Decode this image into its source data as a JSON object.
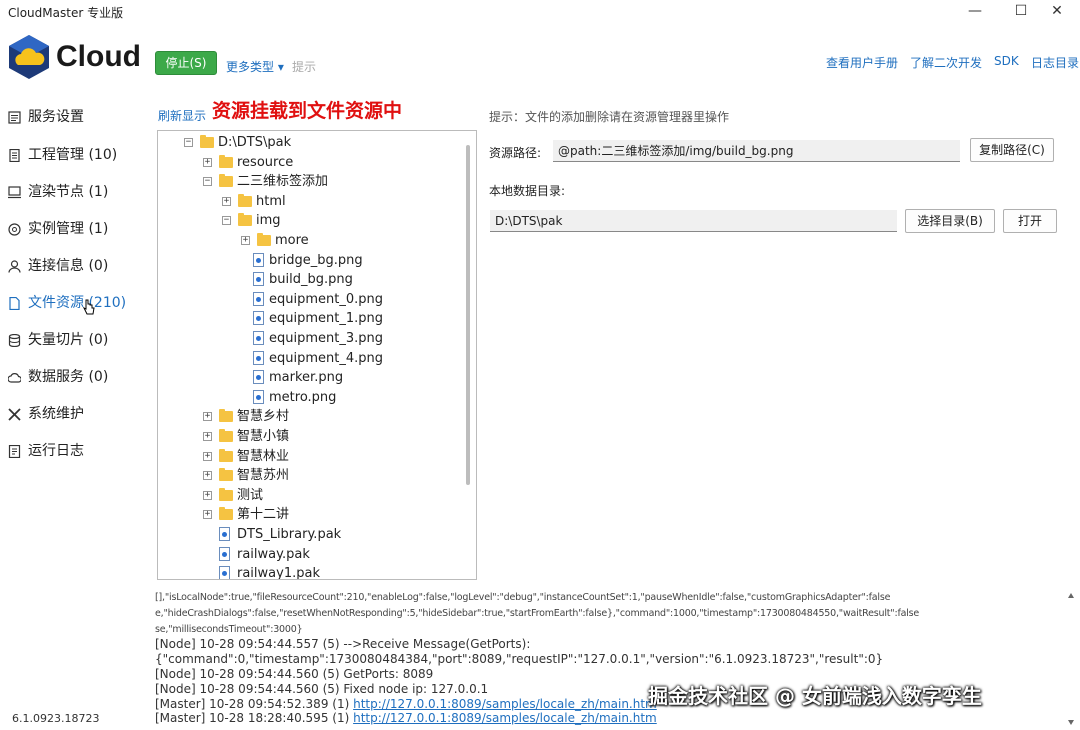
{
  "window": {
    "title": "CloudMaster 专业版",
    "minimize": "—",
    "maximize": "☐",
    "close": "✕"
  },
  "header": {
    "logo_text": "Cloud",
    "stop_button": "停止(S)",
    "more_types": "更多类型 ▾",
    "hint": "提示",
    "links": [
      "查看用户手册",
      "了解二次开发",
      "SDK",
      "日志目录"
    ]
  },
  "sidebar": {
    "items": [
      {
        "label": "服务设置",
        "icon": "list-icon"
      },
      {
        "label": "工程管理 (10)",
        "icon": "document-icon"
      },
      {
        "label": "渲染节点 (1)",
        "icon": "monitor-icon"
      },
      {
        "label": "实例管理 (1)",
        "icon": "instance-icon"
      },
      {
        "label": "连接信息 (0)",
        "icon": "user-icon"
      },
      {
        "label": "文件资源 (210)",
        "icon": "file-icon"
      },
      {
        "label": "矢量切片 (0)",
        "icon": "database-icon"
      },
      {
        "label": "数据服务 (0)",
        "icon": "cloud-icon"
      },
      {
        "label": "系统维护",
        "icon": "tools-icon"
      },
      {
        "label": "运行日志",
        "icon": "log-icon"
      }
    ],
    "active_index": 5,
    "version": "6.1.0923.18723"
  },
  "main": {
    "refresh": "刷新显示",
    "mount_title": "资源挂载到文件资源中",
    "tip": "提示：文件的添加删除请在资源管理器里操作",
    "resource_path_label": "资源路径:",
    "resource_path_value": "@path:二三维标签添加/img/build_bg.png",
    "copy_path_button": "复制路径(C)",
    "local_dir_label": "本地数据目录:",
    "local_dir_value": "D:\\DTS\\pak",
    "choose_dir_button": "选择目录(B)",
    "open_button": "打开"
  },
  "tree": [
    {
      "label": "D:\\DTS\\pak",
      "level": 0,
      "kind": "folder",
      "expander": "−"
    },
    {
      "label": "resource",
      "level": 1,
      "kind": "folder",
      "expander": "+"
    },
    {
      "label": "二三维标签添加",
      "level": 1,
      "kind": "folder",
      "expander": "−"
    },
    {
      "label": "html",
      "level": 2,
      "kind": "folder",
      "expander": "+"
    },
    {
      "label": "img",
      "level": 2,
      "kind": "folder",
      "expander": "−"
    },
    {
      "label": "more",
      "level": 3,
      "kind": "folder",
      "expander": "+"
    },
    {
      "label": "bridge_bg.png",
      "level": 3,
      "kind": "file"
    },
    {
      "label": "build_bg.png",
      "level": 3,
      "kind": "file"
    },
    {
      "label": "equipment_0.png",
      "level": 3,
      "kind": "file"
    },
    {
      "label": "equipment_1.png",
      "level": 3,
      "kind": "file"
    },
    {
      "label": "equipment_3.png",
      "level": 3,
      "kind": "file"
    },
    {
      "label": "equipment_4.png",
      "level": 3,
      "kind": "file"
    },
    {
      "label": "marker.png",
      "level": 3,
      "kind": "file"
    },
    {
      "label": "metro.png",
      "level": 3,
      "kind": "file"
    },
    {
      "label": "智慧乡村",
      "level": 1,
      "kind": "folder",
      "expander": "+"
    },
    {
      "label": "智慧小镇",
      "level": 1,
      "kind": "folder",
      "expander": "+"
    },
    {
      "label": "智慧林业",
      "level": 1,
      "kind": "folder",
      "expander": "+"
    },
    {
      "label": "智慧苏州",
      "level": 1,
      "kind": "folder",
      "expander": "+"
    },
    {
      "label": "测试",
      "level": 1,
      "kind": "folder",
      "expander": "+"
    },
    {
      "label": "第十二讲",
      "level": 1,
      "kind": "folder",
      "expander": "+"
    },
    {
      "label": "DTS_Library.pak",
      "level": 1,
      "kind": "file"
    },
    {
      "label": "railway.pak",
      "level": 1,
      "kind": "file"
    },
    {
      "label": "railway1.pak",
      "level": 1,
      "kind": "file"
    }
  ],
  "log": {
    "json_lines": [
      "[],\"isLocalNode\":true,\"fileResourceCount\":210,\"enableLog\":false,\"logLevel\":\"debug\",\"instanceCountSet\":1,\"pauseWhenIdle\":false,\"customGraphicsAdapter\":false",
      "e,\"hideCrashDialogs\":false,\"resetWhenNotResponding\":5,\"hideSidebar\":true,\"startFromEarth\":false},\"command\":1000,\"timestamp\":1730080484550,\"waitResult\":false",
      "se,\"millisecondsTimeout\":3000}"
    ],
    "lines": [
      {
        "text": "[Node] 10-28 09:54:44.557 (5) -->Receive Message(GetPorts):"
      },
      {
        "text": "{\"command\":0,\"timestamp\":1730080484384,\"port\":8089,\"requestIP\":\"127.0.0.1\",\"version\":\"6.1.0923.18723\",\"result\":0}"
      },
      {
        "text": "[Node] 10-28 09:54:44.560 (5) GetPorts: 8089"
      },
      {
        "text": "[Node] 10-28 09:54:44.560 (5) Fixed node ip: 127.0.0.1"
      },
      {
        "text": "[Master] 10-28 09:54:52.389 (1) ",
        "link": "http://127.0.0.1:8089/samples/locale_zh/main.htm"
      },
      {
        "text": "[Master] 10-28 18:28:40.595 (1) ",
        "link": "http://127.0.0.1:8089/samples/locale_zh/main.htm"
      }
    ]
  },
  "watermark": "掘金技术社区 @ 女前端浅入数字孪生"
}
